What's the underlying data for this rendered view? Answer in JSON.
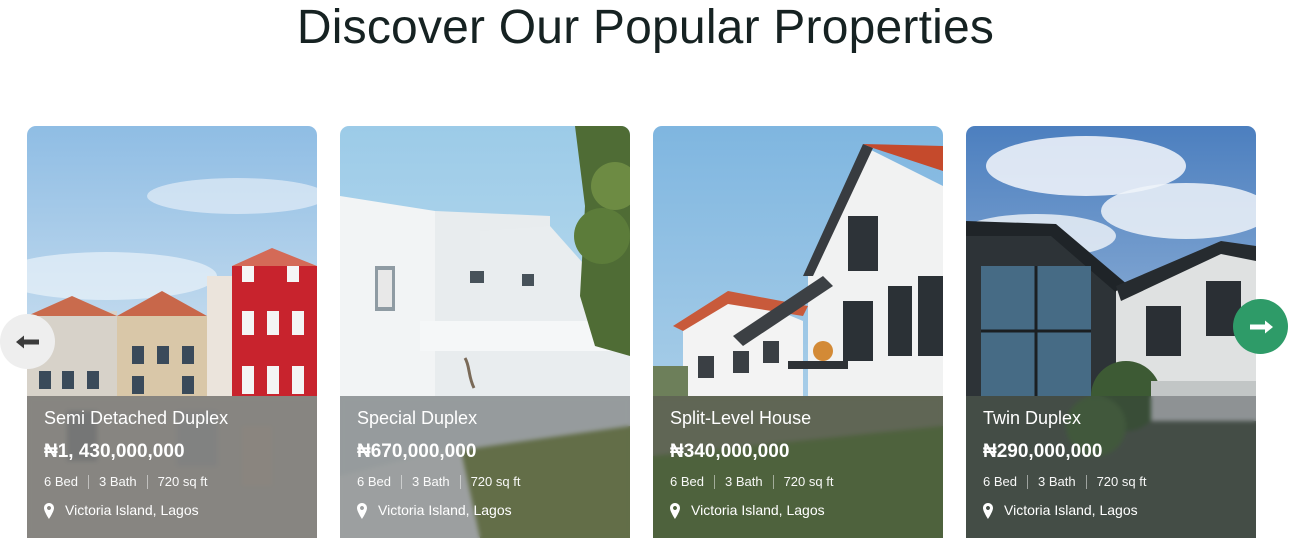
{
  "section": {
    "title": "Discover Our Popular Properties"
  },
  "navigation": {
    "prev_icon": "arrow-left-icon",
    "next_icon": "arrow-right-icon",
    "prev_color": "#eeeeee",
    "next_color": "#2e9b68"
  },
  "cards": [
    {
      "title": "Semi Detached Duplex",
      "price": "₦1, 430,000,000",
      "beds": "6 Bed",
      "baths": "3 Bath",
      "area": "720 sq ft",
      "location": "Victoria Island, Lagos",
      "location_icon": "map-pin-icon"
    },
    {
      "title": "Special Duplex",
      "price": "₦670,000,000",
      "beds": "6 Bed",
      "baths": "3 Bath",
      "area": "720 sq ft",
      "location": "Victoria Island, Lagos",
      "location_icon": "map-pin-icon"
    },
    {
      "title": "Split-Level House",
      "price": "₦340,000,000",
      "beds": "6 Bed",
      "baths": "3 Bath",
      "area": "720 sq ft",
      "location": "Victoria Island, Lagos",
      "location_icon": "map-pin-icon"
    },
    {
      "title": "Twin Duplex",
      "price": "₦290,000,000",
      "beds": "6 Bed",
      "baths": "3 Bath",
      "area": "720 sq ft",
      "location": "Victoria Island, Lagos",
      "location_icon": "map-pin-icon"
    }
  ],
  "colors": {
    "title_text": "#162222",
    "accent": "#2e9b68",
    "overlay_text": "#ffffff"
  }
}
